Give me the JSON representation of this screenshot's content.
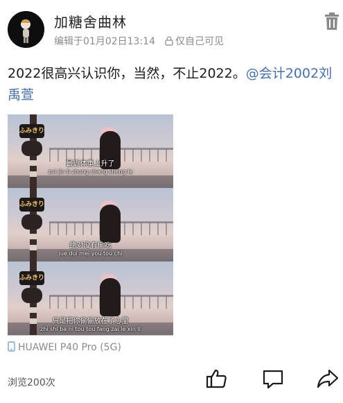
{
  "header": {
    "username": "加糖舍曲林",
    "edited": "编辑于01月02日13:14",
    "privacy": "仅自己可见",
    "icons": {
      "avatar": "avatar",
      "lock": "lock-icon",
      "delete": "trash-icon"
    }
  },
  "post": {
    "text": "2022很高兴认识你，当然，不止2022。",
    "mention": "@会计2002刘禹萱"
  },
  "photo": {
    "panels": [
      {
        "sign": "ふみきり",
        "caption": "最近体重上升了",
        "pinyin": "zui jin ti zhong shang sheng le"
      },
      {
        "sign": "ふみきり",
        "caption": "绝对没有偷吃",
        "pinyin": "jue dui mei you tou chi"
      },
      {
        "sign": "ふみきり",
        "caption": "只是把你偷偷放在了心里",
        "pinyin": "zhi shi ba ni tou tou fang zai le xin li"
      }
    ]
  },
  "device": {
    "label": "HUAWEI P40 Pro (5G)",
    "icon": "phone-icon"
  },
  "footer": {
    "views": "浏览200次",
    "actions": [
      "like-icon",
      "comment-icon",
      "share-icon"
    ]
  }
}
